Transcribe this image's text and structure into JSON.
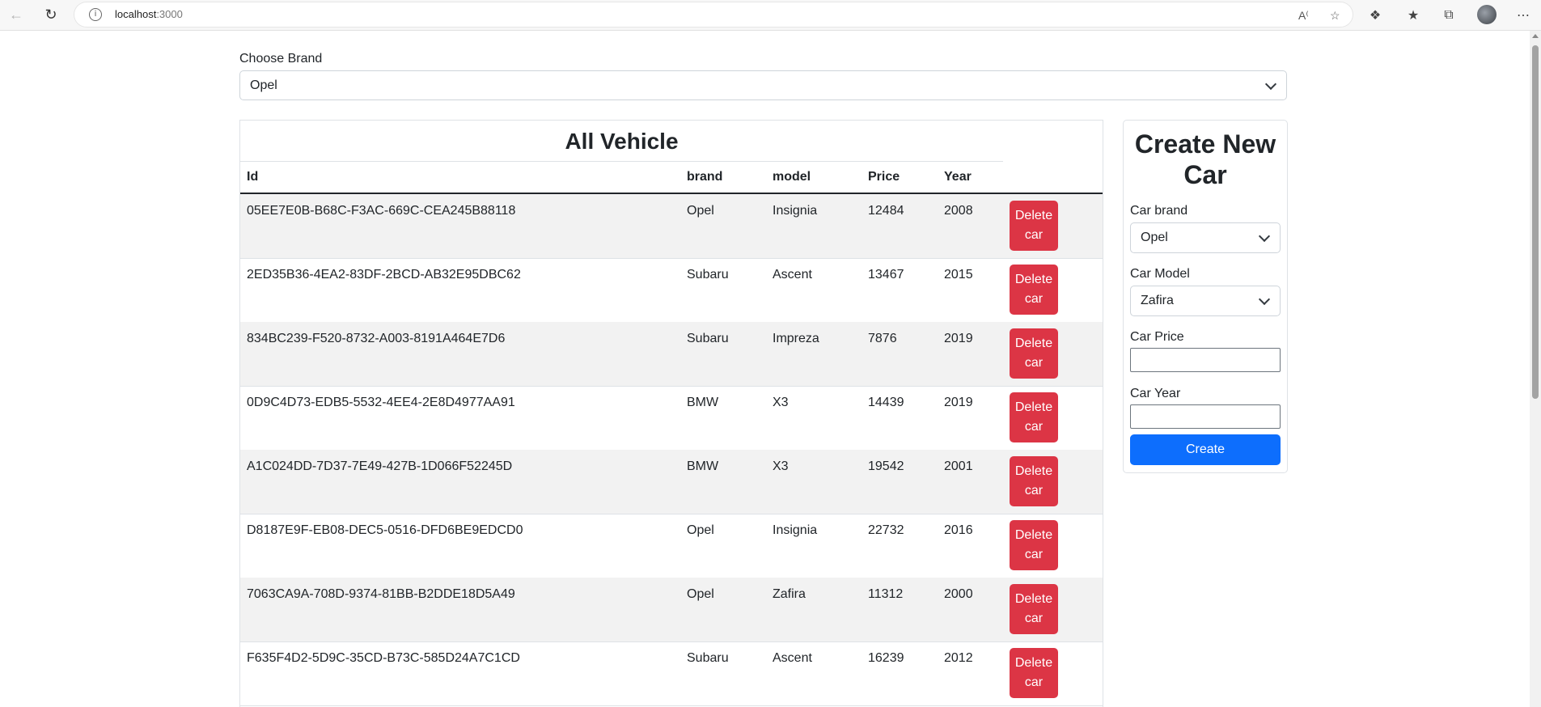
{
  "browser": {
    "url_host": "localhost",
    "url_port": ":3000"
  },
  "brand_filter": {
    "label": "Choose Brand",
    "selected": "Opel"
  },
  "table": {
    "title": "All Vehicle",
    "columns": [
      "Id",
      "brand",
      "model",
      "Price",
      "Year"
    ],
    "delete_label_line1": "Delete",
    "delete_label_line2": "car",
    "rows": [
      {
        "id": "05EE7E0B-B68C-F3AC-669C-CEA245B88118",
        "brand": "Opel",
        "model": "Insignia",
        "price": "12484",
        "year": "2008"
      },
      {
        "id": "2ED35B36-4EA2-83DF-2BCD-AB32E95DBC62",
        "brand": "Subaru",
        "model": "Ascent",
        "price": "13467",
        "year": "2015"
      },
      {
        "id": "834BC239-F520-8732-A003-8191A464E7D6",
        "brand": "Subaru",
        "model": "Impreza",
        "price": "7876",
        "year": "2019"
      },
      {
        "id": "0D9C4D73-EDB5-5532-4EE4-2E8D4977AA91",
        "brand": "BMW",
        "model": "X3",
        "price": "14439",
        "year": "2019"
      },
      {
        "id": "A1C024DD-7D37-7E49-427B-1D066F52245D",
        "brand": "BMW",
        "model": "X3",
        "price": "19542",
        "year": "2001"
      },
      {
        "id": "D8187E9F-EB08-DEC5-0516-DFD6BE9EDCD0",
        "brand": "Opel",
        "model": "Insignia",
        "price": "22732",
        "year": "2016"
      },
      {
        "id": "7063CA9A-708D-9374-81BB-B2DDE18D5A49",
        "brand": "Opel",
        "model": "Zafira",
        "price": "11312",
        "year": "2000"
      },
      {
        "id": "F635F4D2-5D9C-35CD-B73C-585D24A7C1CD",
        "brand": "Subaru",
        "model": "Ascent",
        "price": "16239",
        "year": "2012"
      }
    ]
  },
  "create_form": {
    "title_line1": "Create New",
    "title_line2": "Car",
    "brand_label": "Car brand",
    "brand_value": "Opel",
    "model_label": "Car Model",
    "model_value": "Zafira",
    "price_label": "Car Price",
    "price_value": "",
    "year_label": "Car Year",
    "year_value": "",
    "submit_label": "Create"
  },
  "colors": {
    "danger": "#dc3545",
    "primary": "#0d6efd",
    "striped_row": "#f2f2f2"
  }
}
